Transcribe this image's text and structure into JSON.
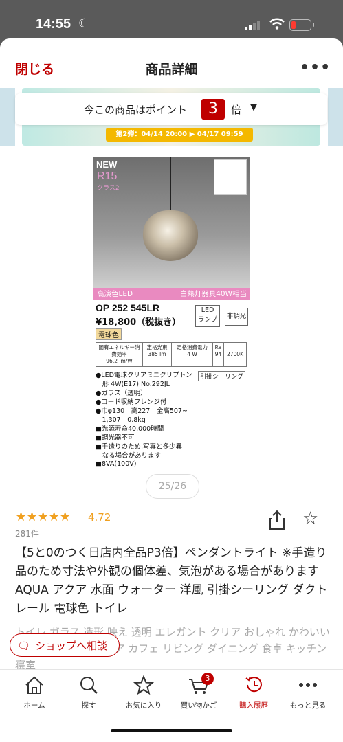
{
  "status": {
    "time": "14:55"
  },
  "header": {
    "close_label": "閉じる",
    "title": "商品詳細",
    "more_label": "•••"
  },
  "banner": {
    "ribbon_text": "第2弾：04/14 20:00 ▶ 04/17 09:59"
  },
  "points": {
    "prefix": "今この商品はポイント",
    "multiplier": "3",
    "suffix": "倍"
  },
  "product_image": {
    "new_label": "NEW",
    "r15_label": "R15",
    "class_label": "クラス2",
    "led_left": "高演色LED",
    "led_right": "白熱灯器具40W相当",
    "model": "OP 252 545LR",
    "price": "¥18,800（税抜き）",
    "color_label": "電球色",
    "badge_led": "LED\nランプ",
    "badge_dim": "非調光",
    "spec": [
      {
        "head": "固有エネルギー消費効率",
        "val": "96.2 lm/W"
      },
      {
        "head": "定格光束",
        "val": "385 lm"
      },
      {
        "head": "定格消費電力",
        "val": "4 W"
      },
      {
        "head": "Ra",
        "val": "94"
      },
      {
        "head": "",
        "val": "2700K"
      }
    ],
    "hook": "引掛シーリング",
    "bullets": [
      "●LED電球クリアミニクリプトン",
      "　形 4W(E17) No.292JL",
      "●ガラス（透明）",
      "●コード収納フレンジ付",
      "●巾φ130　高227　全高507~",
      "　1,307　0.8kg",
      "■光源寿命40,000時間",
      "■調光器不可",
      "■手造りのため,写真と多少異",
      "　なる場合があります",
      "■8VA(100V)"
    ]
  },
  "pager": {
    "text": "25/26"
  },
  "rating": {
    "stars": "★★★★★",
    "value": "4.72",
    "count": "281件"
  },
  "product": {
    "title": "【5と0のつく日店内全品P3倍】ペンダントライト ※手造り品のため寸法や外観の個体差、気泡がある場合があります AQUA アクア 水面 ウォーター 洋風 引掛シーリング ダクトレール 電球色 トイレ",
    "tags": "トイレ ガラス 造形 映え 透明 エレガント クリア おしゃれ かわいい 北欧 モダン インテリア カフェ リビング ダイニング 食卓 キッチン 寝室"
  },
  "consult": {
    "label": "ショップへ相談"
  },
  "bottom_nav": {
    "items": [
      {
        "label": "ホーム"
      },
      {
        "label": "探す"
      },
      {
        "label": "お気に入り"
      },
      {
        "label": "買い物かご"
      },
      {
        "label": "購入履歴"
      },
      {
        "label": "もっと見る"
      }
    ],
    "cart_count": "3"
  },
  "colors": {
    "accent": "#bf0000",
    "star": "#f0a020",
    "pink": "#e98ac0"
  }
}
